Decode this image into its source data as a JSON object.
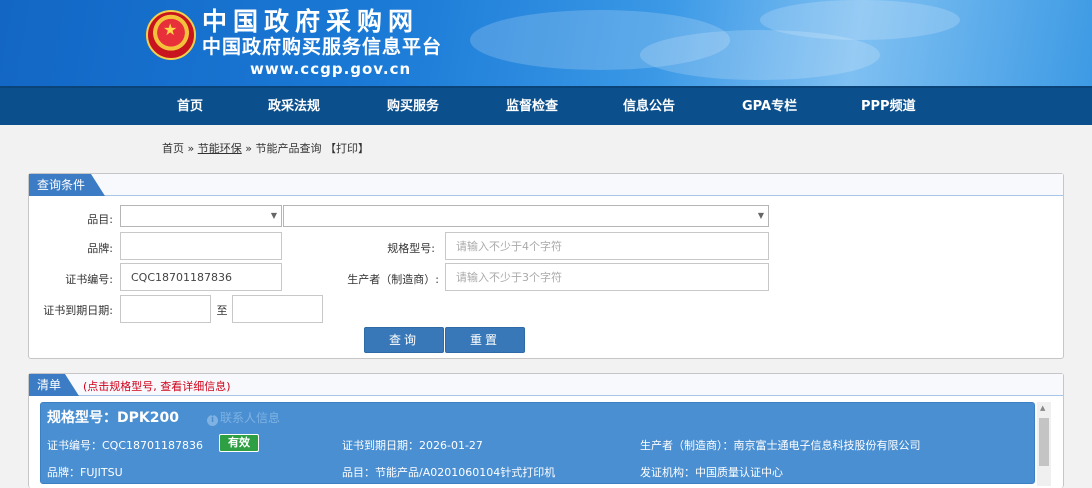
{
  "header": {
    "site_title": "中国政府采购网",
    "site_subtitle": "中国政府购买服务信息平台",
    "site_url": "www.ccgp.gov.cn"
  },
  "nav": {
    "items": [
      "首页",
      "政采法规",
      "购买服务",
      "监督检查",
      "信息公告",
      "GPA专栏",
      "PPP频道"
    ]
  },
  "breadcrumb": {
    "home": "首页",
    "sep1": " » ",
    "section": "节能环保",
    "sep2": " » ",
    "current": "节能产品查询",
    "print": " 【打印】"
  },
  "query": {
    "title": "查询条件",
    "category_label": "品目:",
    "brand_label": "品牌:",
    "model_label": "规格型号:",
    "model_placeholder": "请输入不少于4个字符",
    "cert_label": "证书编号:",
    "cert_value": "CQC18701187836",
    "maker_label": "生产者（制造商）:",
    "maker_placeholder": "请输入不少于3个字符",
    "expiry_label": "证书到期日期:",
    "to_label": "至",
    "search_button": "查询",
    "reset_button": "重置"
  },
  "list": {
    "title": "清单",
    "hint": "(点击规格型号, 查看详细信息)"
  },
  "result": {
    "model": "规格型号：DPK200",
    "contact": "联系人信息",
    "cert": "证书编号：CQC18701187836",
    "status": "有效",
    "expiry": "证书到期日期：2026-01-27",
    "maker": "生产者（制造商）：南京富士通电子信息科技股份有限公司",
    "brand": "品牌：FUJITSU",
    "category": "品目：节能产品/A0201060104针式打印机",
    "issuer": "发证机构：中国质量认证中心"
  },
  "colors": {
    "nav_bg": "#0b4f8c",
    "card_bg": "#4a8fd2",
    "button_bg": "#3978b8",
    "status_green": "#2ea043",
    "hint_red": "#d0021b"
  }
}
